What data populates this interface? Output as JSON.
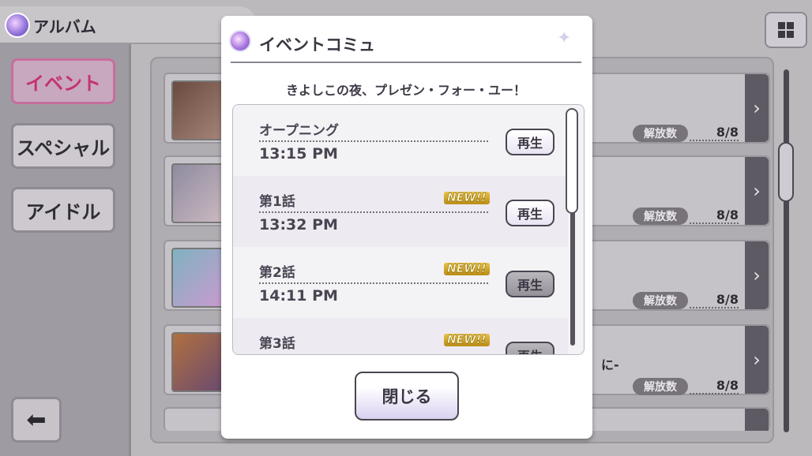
{
  "album": {
    "title": "アルバム",
    "grid_icon": "grid-icon",
    "back_icon": "back-arrow-icon"
  },
  "sidebar": {
    "items": [
      {
        "label": "イベント",
        "active": true
      },
      {
        "label": "スペシャル",
        "active": false
      },
      {
        "label": "アイドル",
        "active": false
      }
    ]
  },
  "cards": [
    {
      "badge": "解放数",
      "count": "8/8",
      "text": ""
    },
    {
      "badge": "解放数",
      "count": "8/8",
      "text": ""
    },
    {
      "badge": "解放数",
      "count": "8/8",
      "text": ""
    },
    {
      "badge": "解放数",
      "count": "8/8",
      "text": "に-"
    }
  ],
  "modal": {
    "title": "イベントコミュ",
    "event_name": "きよしこの夜、プレゼン・フォー・ユー！",
    "close_label": "閉じる",
    "episodes": [
      {
        "label": "オープニング",
        "time": "13:15 PM",
        "new": "",
        "play_label": "再生"
      },
      {
        "label": "第1話",
        "time": "13:32 PM",
        "new": "NEW!!",
        "play_label": "再生"
      },
      {
        "label": "第2話",
        "time": "14:11 PM",
        "new": "NEW!!",
        "play_label": "再生"
      },
      {
        "label": "第3話",
        "time": "",
        "new": "NEW!!",
        "play_label": "再生"
      }
    ]
  },
  "colors": {
    "accent_pink": "#c3346c",
    "modal_bg": "#ffffff",
    "dim_overlay": "#bcb9bd"
  }
}
